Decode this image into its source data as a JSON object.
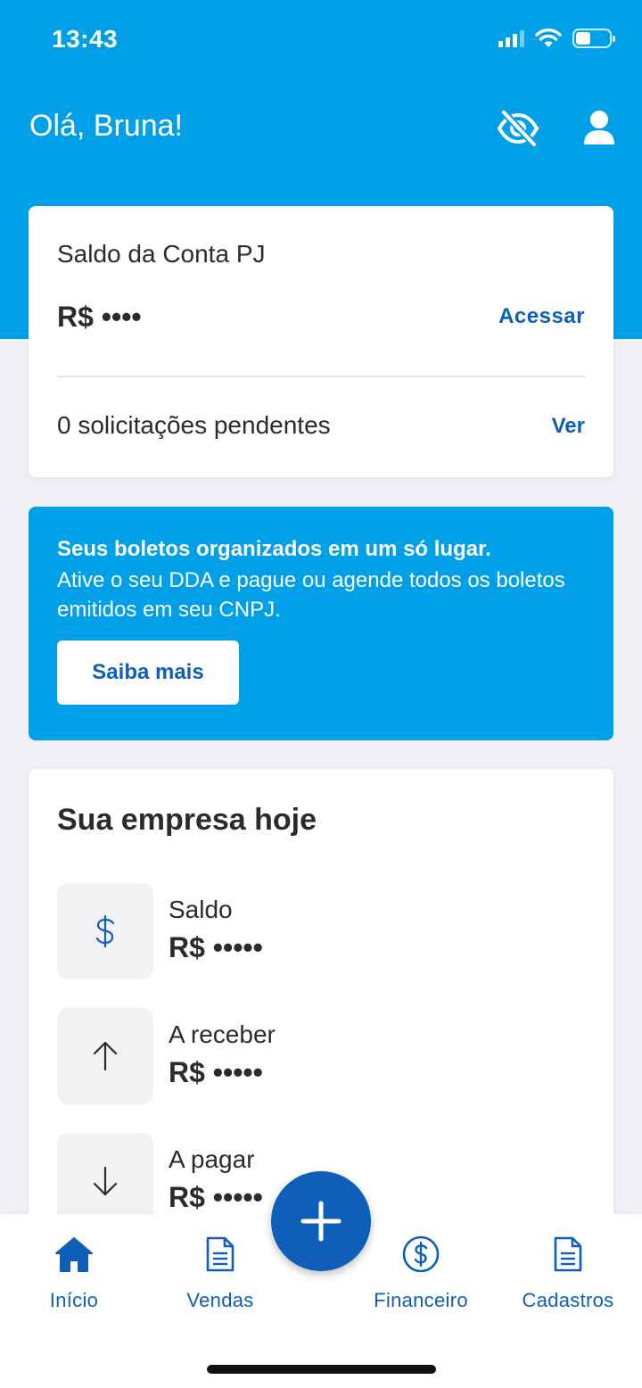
{
  "status_bar": {
    "time": "13:43"
  },
  "header": {
    "greeting": "Olá, Bruna!",
    "icons": [
      "eye-off-icon",
      "user-icon"
    ]
  },
  "account_card": {
    "title": "Saldo da Conta PJ",
    "balance": "R$ ••••",
    "access_label": "Acessar",
    "pending_text": "0 solicitações pendentes",
    "view_label": "Ver"
  },
  "promo": {
    "title": "Seus boletos organizados em um só lugar.",
    "text": "Ative o seu DDA e pague ou agende todos os boletos emitidos em seu CNPJ.",
    "button_label": "Saiba mais"
  },
  "company_today": {
    "title": "Sua empresa hoje",
    "metrics": [
      {
        "label": "Saldo",
        "value": "R$ •••••",
        "icon": "dollar-icon"
      },
      {
        "label": "A receber",
        "value": "R$ •••••",
        "icon": "arrow-up-icon"
      },
      {
        "label": "A pagar",
        "value": "R$ •••••",
        "icon": "arrow-down-icon"
      }
    ]
  },
  "nav": {
    "items": [
      {
        "label": "Início",
        "icon": "home-icon"
      },
      {
        "label": "Vendas",
        "icon": "document-icon"
      },
      {
        "label": "Financeiro",
        "icon": "dollar-circle-icon"
      },
      {
        "label": "Cadastros",
        "icon": "document-icon"
      }
    ],
    "fab_icon": "plus-icon"
  },
  "colors": {
    "brand_light": "#00a0e9",
    "brand_dark": "#0e5fb8",
    "background": "#eef0f5"
  }
}
